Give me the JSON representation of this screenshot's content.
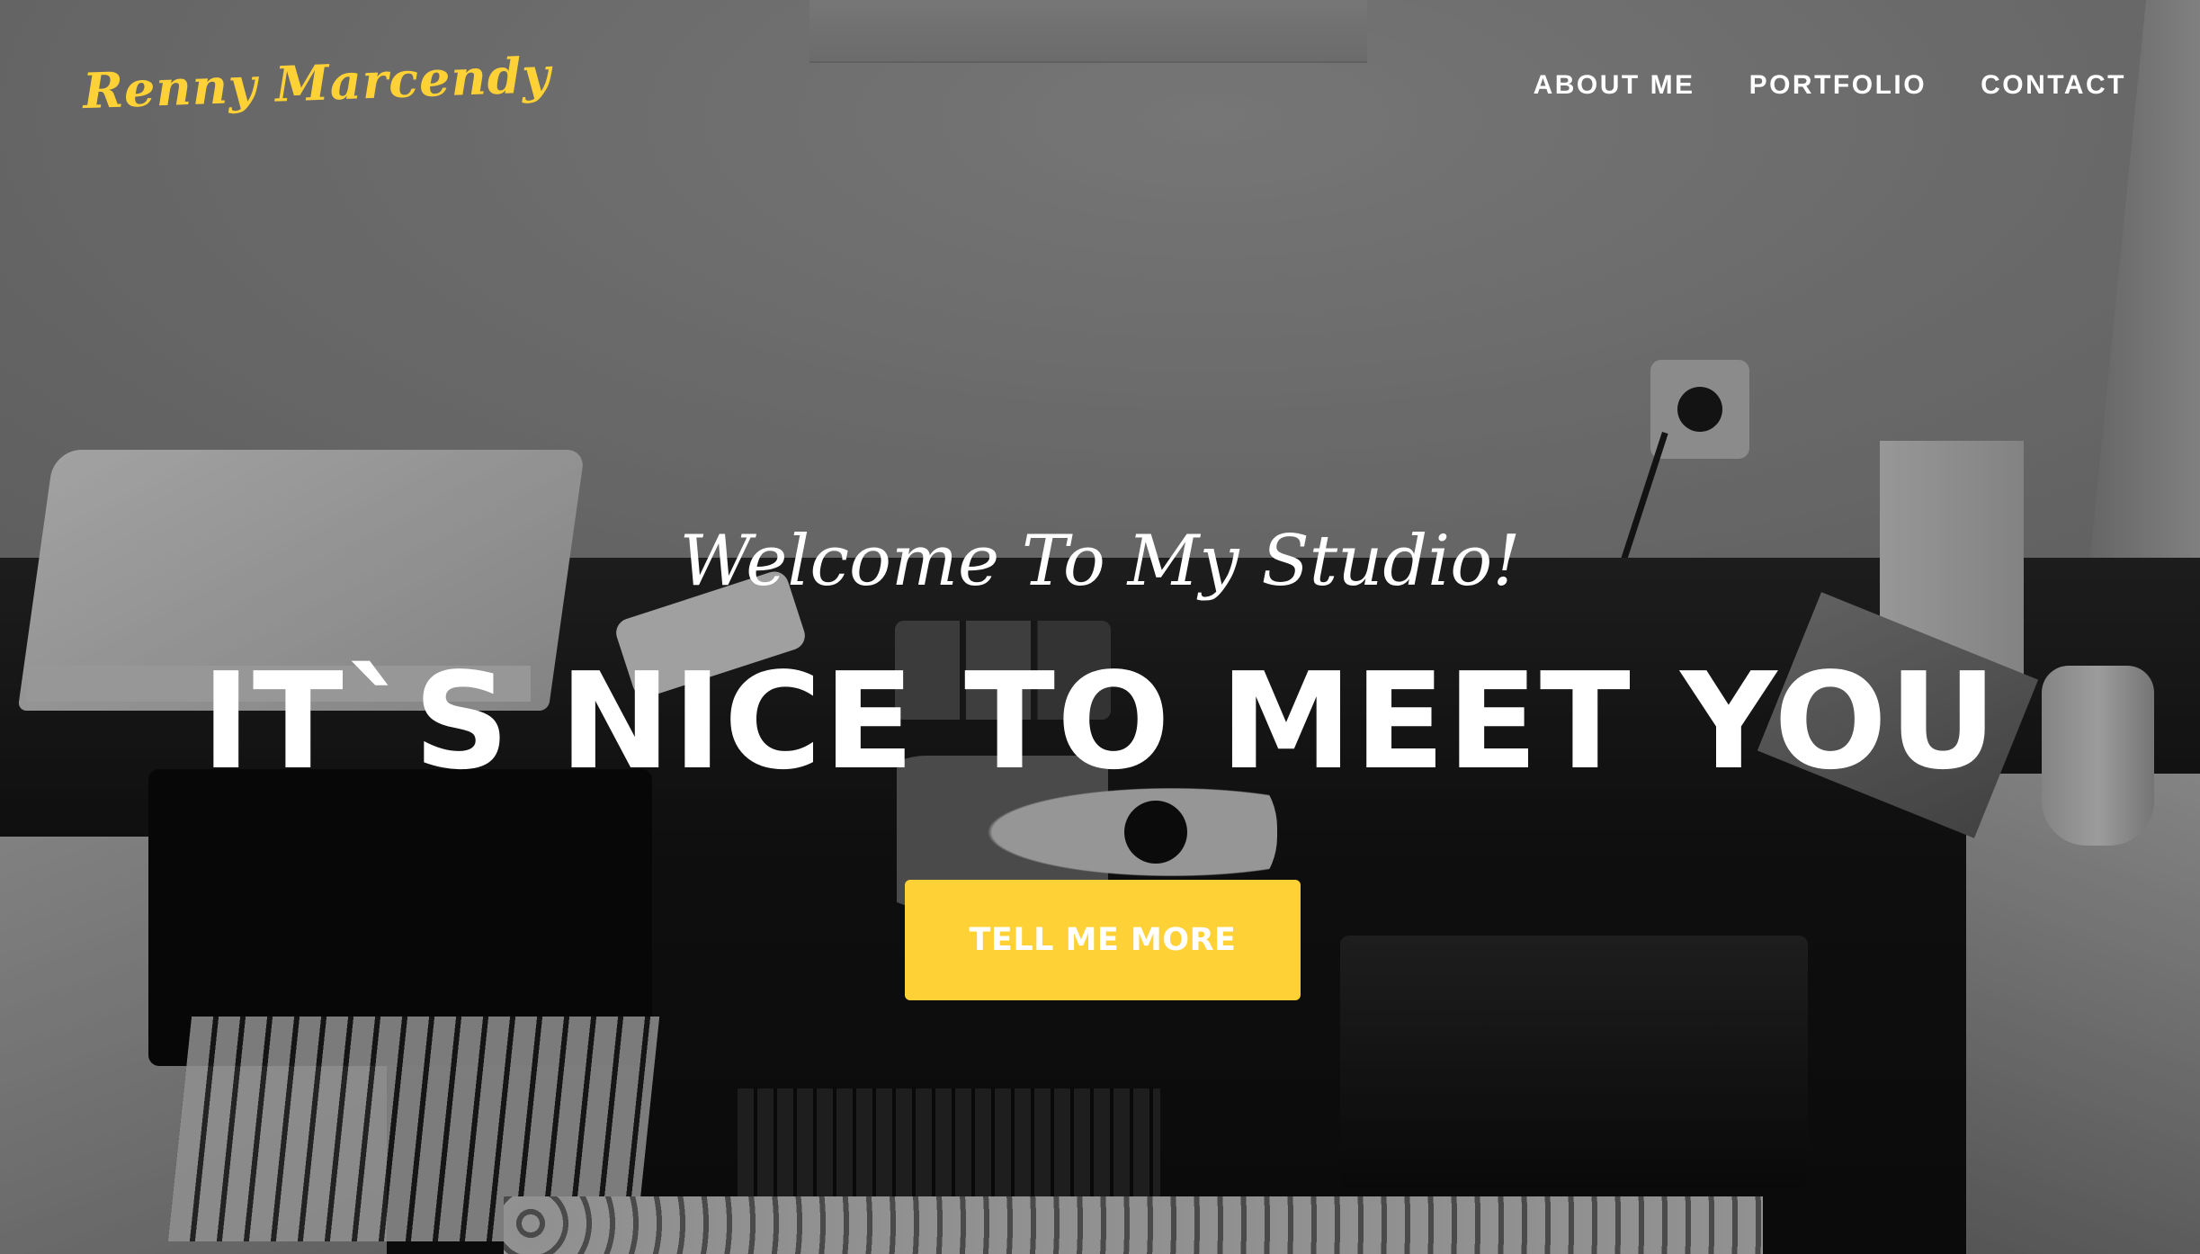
{
  "navbar": {
    "brand": "Renny Marcendy",
    "links": [
      {
        "label": "ABOUT ME"
      },
      {
        "label": "PORTFOLIO"
      },
      {
        "label": "CONTACT"
      }
    ]
  },
  "hero": {
    "subheading": "Welcome To My Studio!",
    "heading": "IT`S NICE TO MEET YOU",
    "button_label": "TELL ME MORE",
    "background": "grayscale studio desk photo"
  },
  "colors": {
    "accent": "#fed136",
    "text": "#ffffff"
  }
}
